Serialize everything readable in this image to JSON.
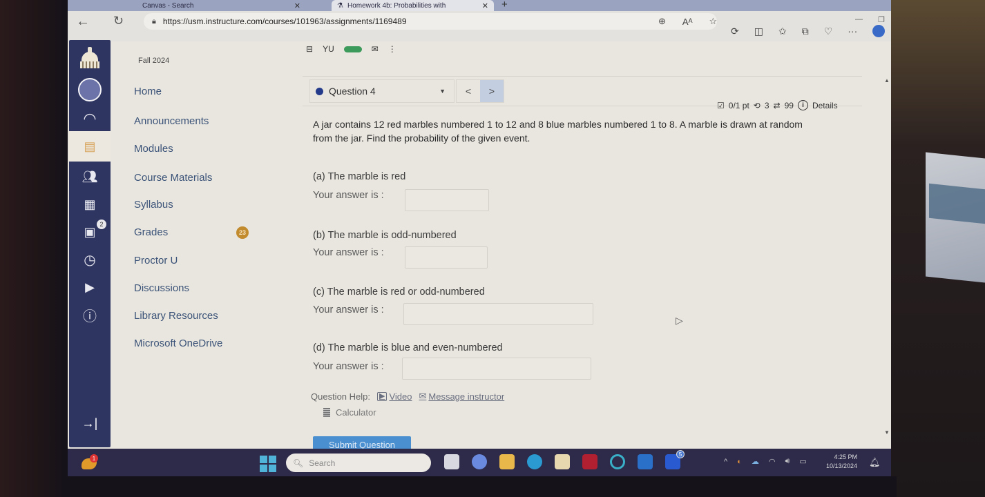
{
  "browser": {
    "tabs": [
      {
        "label": "Canvas - Search",
        "active": false
      },
      {
        "label": "Homework 4b: Probabilities with",
        "active": true
      }
    ],
    "new_tab_icon": "plus-icon",
    "url": "https://usm.instructure.com/courses/101963/assignments/1169489",
    "toolbar_icons": [
      "zoom-icon",
      "read-aloud-icon",
      "favorite-star-icon",
      "extensions-icon",
      "split-screen-icon",
      "favorites-icon",
      "collections-icon",
      "browser-essentials-icon",
      "more-icon",
      "profile-icon"
    ],
    "window_controls": [
      "minimize",
      "restore",
      "close"
    ]
  },
  "global_nav": {
    "items": [
      {
        "name": "logo",
        "icon": "university-dome-logo"
      },
      {
        "name": "account",
        "icon": "avatar-icon"
      },
      {
        "name": "dashboard",
        "icon": "dashboard-gauge-icon"
      },
      {
        "name": "courses",
        "icon": "book-icon",
        "active": true
      },
      {
        "name": "groups",
        "icon": "people-icon"
      },
      {
        "name": "calendar",
        "icon": "calendar-icon"
      },
      {
        "name": "inbox",
        "icon": "inbox-icon",
        "badge": "2"
      },
      {
        "name": "history",
        "icon": "clock-icon"
      },
      {
        "name": "studio",
        "icon": "media-icon"
      },
      {
        "name": "help",
        "icon": "help-info-icon"
      }
    ],
    "collapse_icon": "collapse-arrow-icon"
  },
  "course": {
    "term": "Fall 2024",
    "nav": [
      {
        "label": "Home"
      },
      {
        "label": "Announcements"
      },
      {
        "label": "Modules"
      },
      {
        "label": "Course Materials"
      },
      {
        "label": "Syllabus"
      },
      {
        "label": "Grades",
        "badge": "23"
      },
      {
        "label": "Proctor U"
      },
      {
        "label": "Discussions"
      },
      {
        "label": "Library Resources"
      },
      {
        "label": "Microsoft OneDrive"
      }
    ]
  },
  "question": {
    "selector_label": "Question 4",
    "prev_label": "<",
    "next_label": ">",
    "score": "0/1 pt",
    "retries": "3",
    "submissions": "99",
    "details_label": "Details",
    "text": "A jar contains 12 red marbles numbered 1 to 12 and 8 blue marbles numbered 1 to 8. A marble is drawn at random from the jar. Find the probability of the given event.",
    "parts": [
      {
        "label": "(a) The marble is red",
        "answer_label": "Your answer is :",
        "value": ""
      },
      {
        "label": "(b) The marble is odd-numbered",
        "answer_label": "Your answer is :",
        "value": ""
      },
      {
        "label": "(c) The marble is red or odd-numbered",
        "answer_label": "Your answer is :",
        "value": ""
      },
      {
        "label": "(d) The marble is blue and even-numbered",
        "answer_label": "Your answer is :",
        "value": ""
      }
    ],
    "help_label": "Question Help:",
    "video_label": "Video",
    "message_label": "Message instructor",
    "calculator_label": "Calculator",
    "submit_label": "Submit Question"
  },
  "taskbar": {
    "widget_badge": "1",
    "search_placeholder": "Search",
    "apps": [
      {
        "name": "task-view",
        "color": "#d8d8e0"
      },
      {
        "name": "copilot",
        "color": "#6a8ae0"
      },
      {
        "name": "file-explorer",
        "color": "#e8b84a"
      },
      {
        "name": "edge",
        "color": "#2a9ad0"
      },
      {
        "name": "store",
        "color": "#e8d8b0"
      },
      {
        "name": "mcafee",
        "color": "#b02030"
      },
      {
        "name": "cortana",
        "color": "#3ab0c8"
      },
      {
        "name": "outlook",
        "color": "#2a70c8"
      },
      {
        "name": "teams-l",
        "color": "#2a5ad0",
        "badge": "5"
      }
    ],
    "time": "4:25 PM",
    "date": "10/13/2024"
  }
}
